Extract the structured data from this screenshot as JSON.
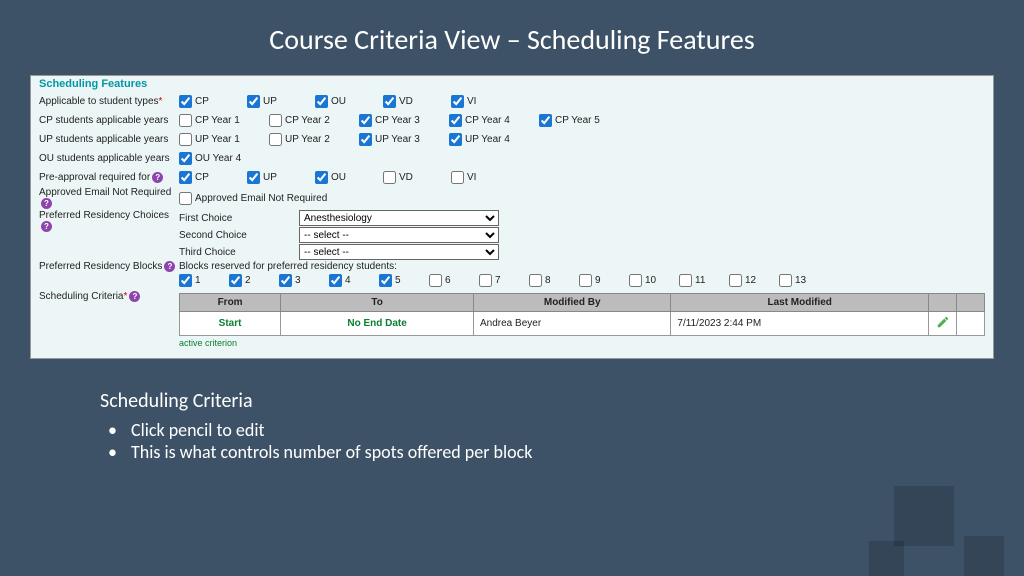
{
  "slide": {
    "title": "Course Criteria View – Scheduling Features"
  },
  "panel": {
    "heading": "Scheduling Features",
    "rows": {
      "student_types": {
        "label": "Applicable to student types",
        "required": true,
        "options": [
          {
            "label": "CP",
            "checked": true
          },
          {
            "label": "UP",
            "checked": true
          },
          {
            "label": "OU",
            "checked": true
          },
          {
            "label": "VD",
            "checked": true
          },
          {
            "label": "VI",
            "checked": true
          }
        ]
      },
      "cp_years": {
        "label": "CP students applicable years",
        "options": [
          {
            "label": "CP Year 1",
            "checked": false
          },
          {
            "label": "CP Year 2",
            "checked": false
          },
          {
            "label": "CP Year 3",
            "checked": true
          },
          {
            "label": "CP Year 4",
            "checked": true
          },
          {
            "label": "CP Year 5",
            "checked": true
          }
        ]
      },
      "up_years": {
        "label": "UP students applicable years",
        "options": [
          {
            "label": "UP Year 1",
            "checked": false
          },
          {
            "label": "UP Year 2",
            "checked": false
          },
          {
            "label": "UP Year 3",
            "checked": true
          },
          {
            "label": "UP Year 4",
            "checked": true
          }
        ]
      },
      "ou_years": {
        "label": "OU students applicable years",
        "options": [
          {
            "label": "OU Year 4",
            "checked": true
          }
        ]
      },
      "preapproval": {
        "label": "Pre-approval required for",
        "help": true,
        "options": [
          {
            "label": "CP",
            "checked": true
          },
          {
            "label": "UP",
            "checked": true
          },
          {
            "label": "OU",
            "checked": true
          },
          {
            "label": "VD",
            "checked": false
          },
          {
            "label": "VI",
            "checked": false
          }
        ]
      },
      "approved_email": {
        "label": "Approved Email Not Required",
        "help": true,
        "option_label": "Approved Email Not Required",
        "checked": false
      },
      "pref_choices": {
        "label": "Preferred Residency Choices",
        "help": true,
        "choices": [
          {
            "label": "First Choice",
            "value": "Anesthesiology"
          },
          {
            "label": "Second Choice",
            "value": "-- select --"
          },
          {
            "label": "Third Choice",
            "value": "-- select --"
          }
        ]
      },
      "pref_blocks": {
        "label": "Preferred Residency Blocks",
        "help": true,
        "note": "Blocks reserved for preferred residency students:",
        "options": [
          {
            "label": "1",
            "checked": true
          },
          {
            "label": "2",
            "checked": true
          },
          {
            "label": "3",
            "checked": true
          },
          {
            "label": "4",
            "checked": true
          },
          {
            "label": "5",
            "checked": true
          },
          {
            "label": "6",
            "checked": false
          },
          {
            "label": "7",
            "checked": false
          },
          {
            "label": "8",
            "checked": false
          },
          {
            "label": "9",
            "checked": false
          },
          {
            "label": "10",
            "checked": false
          },
          {
            "label": "11",
            "checked": false
          },
          {
            "label": "12",
            "checked": false
          },
          {
            "label": "13",
            "checked": false
          }
        ]
      },
      "scheduling_criteria": {
        "label": "Scheduling Criteria",
        "required": true,
        "help": true,
        "table": {
          "headers": [
            "From",
            "To",
            "Modified By",
            "Last Modified"
          ],
          "row": {
            "from": "Start",
            "to": "No End Date",
            "modified_by": "Andrea Beyer",
            "last_modified": "7/11/2023 2:44 PM"
          },
          "footer_link": "active criterion"
        }
      }
    }
  },
  "footer": {
    "heading": "Scheduling Criteria",
    "bullets": [
      "Click pencil to edit",
      "This is what controls number of spots offered per block"
    ]
  }
}
